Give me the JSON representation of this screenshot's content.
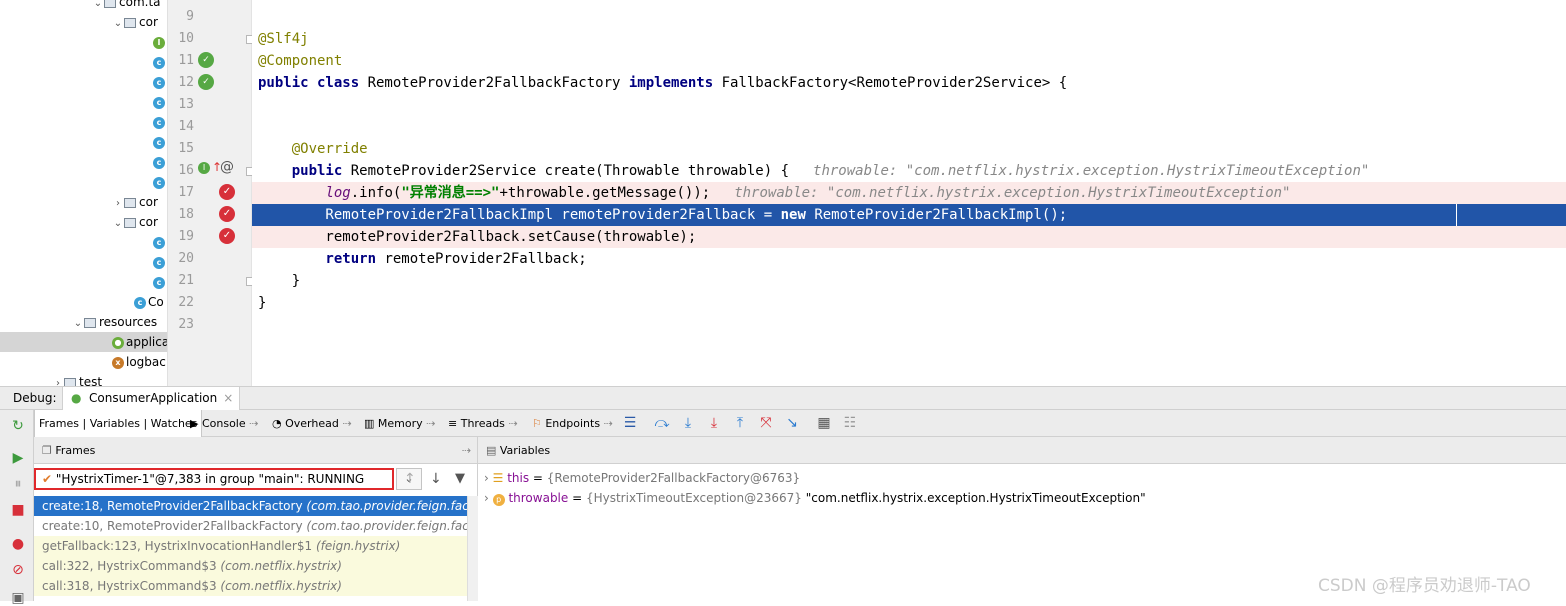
{
  "project_tree": {
    "items": [
      {
        "label": "com.ta",
        "kind": "package"
      },
      {
        "label": "cor",
        "kind": "package"
      },
      {
        "label": "",
        "kind": "interface"
      },
      {
        "label": "",
        "kind": "class"
      },
      {
        "label": "",
        "kind": "class"
      },
      {
        "label": "",
        "kind": "class"
      },
      {
        "label": "",
        "kind": "class"
      },
      {
        "label": "",
        "kind": "class"
      },
      {
        "label": "",
        "kind": "class"
      },
      {
        "label": "",
        "kind": "class"
      },
      {
        "label": "cor",
        "kind": "package"
      },
      {
        "label": "cor",
        "kind": "package"
      },
      {
        "label": "",
        "kind": "class"
      },
      {
        "label": "",
        "kind": "class"
      },
      {
        "label": "",
        "kind": "class"
      },
      {
        "label": "Co",
        "kind": "class"
      },
      {
        "label": "resources",
        "kind": "folder"
      },
      {
        "label": "applica",
        "kind": "file"
      },
      {
        "label": "logbac",
        "kind": "file"
      },
      {
        "label": "test",
        "kind": "folder"
      }
    ]
  },
  "editor": {
    "lines": [
      {
        "num": "9",
        "code": ""
      },
      {
        "num": "10",
        "code": "@Slf4j"
      },
      {
        "num": "11",
        "code": "@Component"
      },
      {
        "num": "12",
        "code_kw1": "public class ",
        "code_main": "RemoteProvider2FallbackFactory ",
        "code_kw2": "implements ",
        "code_rest": "FallbackFactory<RemoteProvider2Service> {"
      },
      {
        "num": "13",
        "code": ""
      },
      {
        "num": "14",
        "code": ""
      },
      {
        "num": "15",
        "code": "    @Override"
      },
      {
        "num": "16",
        "code_kw": "    public ",
        "code_main": "RemoteProvider2Service create(Throwable throwable) {",
        "hint": "throwable: \"com.netflix.hystrix.exception.HystrixTimeoutException\""
      },
      {
        "num": "17",
        "code_log": "log",
        "code_a": ".info(",
        "code_str": "\"异常消息==>\"",
        "code_b": "+throwable.getMessage());",
        "hint": "throwable: \"com.netflix.hystrix.exception.HystrixTimeoutException\""
      },
      {
        "num": "18",
        "code_a": "        RemoteProvider2FallbackImpl remoteProvider2Fallback = ",
        "code_kw": "new ",
        "code_b": "RemoteProvider2FallbackImpl();"
      },
      {
        "num": "19",
        "code": "        remoteProvider2Fallback.setCause(throwable);"
      },
      {
        "num": "20",
        "code_kw": "        return ",
        "code_b": "remoteProvider2Fallback;"
      },
      {
        "num": "21",
        "code": "    }"
      },
      {
        "num": "22",
        "code": "}"
      },
      {
        "num": "23",
        "code": ""
      }
    ]
  },
  "debug": {
    "label": "Debug:",
    "session_tab": "ConsumerApplication",
    "tabs": [
      "Frames | Variables | Watches",
      "Console",
      "Overhead",
      "Memory",
      "Threads",
      "Endpoints"
    ],
    "frames_title": "Frames",
    "variables_title": "Variables",
    "thread": "\"HystrixTimer-1\"@7,383 in group \"main\": RUNNING",
    "frames": [
      {
        "method": "create:18, RemoteProvider2FallbackFactory",
        "pkg": "(com.tao.provider.feign.factory)"
      },
      {
        "method": "create:10, RemoteProvider2FallbackFactory",
        "pkg": "(com.tao.provider.feign.factory)"
      },
      {
        "method": "getFallback:123, HystrixInvocationHandler$1",
        "pkg": "(feign.hystrix)"
      },
      {
        "method": "call:322, HystrixCommand$3",
        "pkg": "(com.netflix.hystrix)"
      },
      {
        "method": "call:318, HystrixCommand$3",
        "pkg": "(com.netflix.hystrix)"
      }
    ],
    "variables": [
      {
        "name": "this",
        "eq": " = ",
        "type": "{RemoteProvider2FallbackFactory@6763}",
        "value": ""
      },
      {
        "name": "throwable",
        "eq": " = ",
        "type": "{HystrixTimeoutException@23667}",
        "value": " \"com.netflix.hystrix.exception.HystrixTimeoutException\""
      }
    ]
  },
  "watermark": "CSDN @程序员劝退师-TAO"
}
